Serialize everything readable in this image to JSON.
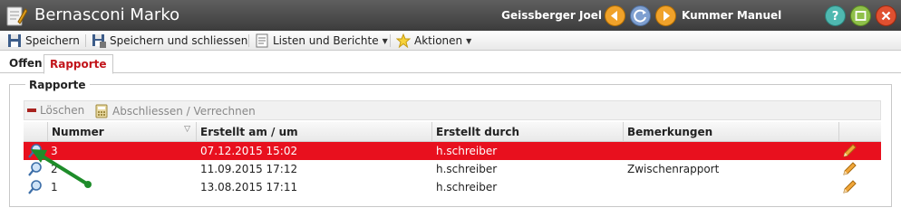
{
  "window": {
    "title": "Bernasconi Marko",
    "prev_person": "Geissberger Joel",
    "next_person": "Kummer Manuel"
  },
  "toolbar": {
    "save": "Speichern",
    "save_close": "Speichern und schliessen",
    "lists_reports": "Listen und Berichte",
    "actions": "Aktionen"
  },
  "tabs": [
    {
      "label": "Offen"
    },
    {
      "label": "Rapporte"
    }
  ],
  "section": {
    "legend": "Rapporte",
    "delete": "Löschen",
    "finalize": "Abschliessen / Verrechnen"
  },
  "grid": {
    "columns": [
      "Nummer",
      "Erstellt am / um",
      "Erstellt durch",
      "Bemerkungen"
    ],
    "rows": [
      {
        "number": "3",
        "created": "07.12.2015 15:02",
        "by": "h.schreiber",
        "remarks": ""
      },
      {
        "number": "2",
        "created": "11.09.2015 17:12",
        "by": "h.schreiber",
        "remarks": "Zwischenrapport"
      },
      {
        "number": "1",
        "created": "13.08.2015 17:11",
        "by": "h.schreiber",
        "remarks": ""
      }
    ]
  },
  "colors": {
    "selected_row": "#e8101e",
    "active_tab_text": "#c2141a",
    "annotation_arrow": "#1e8c2a"
  }
}
